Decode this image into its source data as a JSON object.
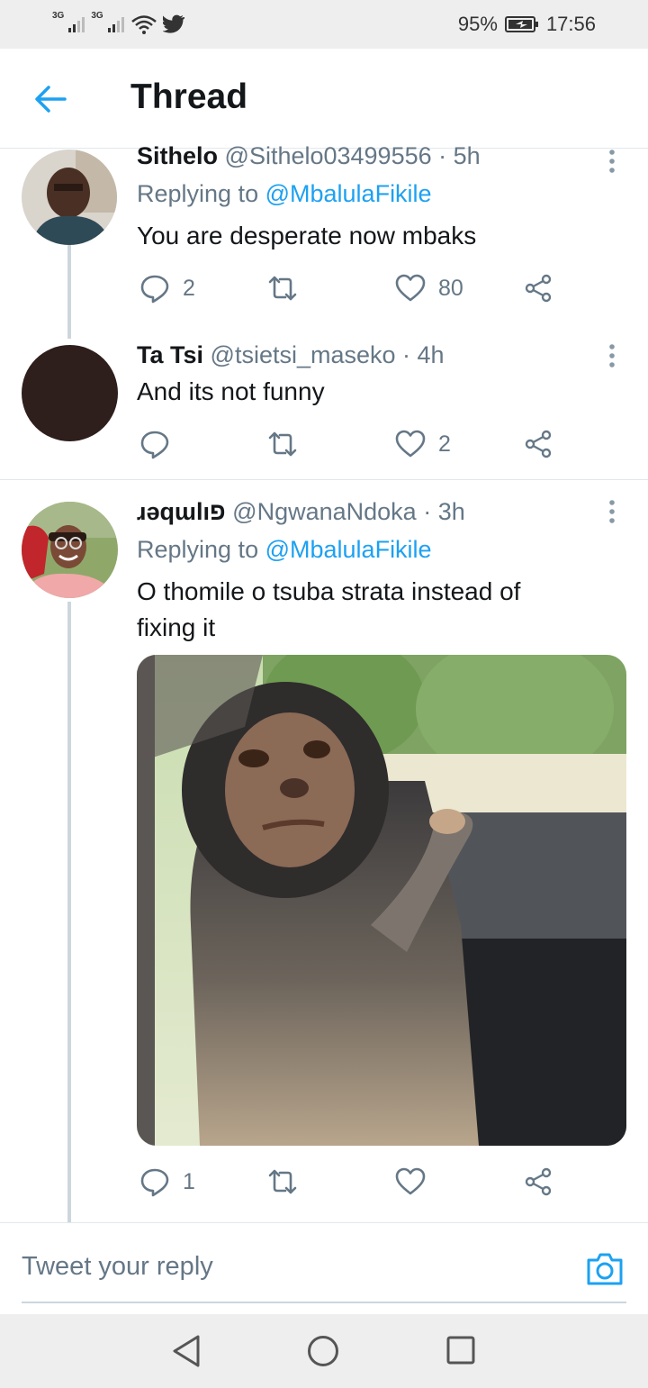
{
  "status_bar": {
    "signal1": "3G",
    "signal2": "3G",
    "battery_percent": "95%",
    "time": "17:56"
  },
  "header": {
    "title": "Thread"
  },
  "tweets": [
    {
      "name": "Sithelo",
      "handle": "@Sithelo03499556",
      "time": "· 5h",
      "replying_prefix": "Replying to",
      "replying_to": "@MbalulaFikile",
      "text": "You are desperate now mbaks",
      "replies": "2",
      "retweets": "",
      "likes": "80"
    },
    {
      "name": "Ta Tsi",
      "handle": "@tsietsi_maseko",
      "time": "· 4h",
      "text": "And its not funny",
      "replies": "",
      "retweets": "",
      "likes": "2"
    },
    {
      "name": "ɹǝqɯlıפ",
      "handle": "@NgwanaNdoka",
      "time": "· 3h",
      "replying_prefix": "Replying to",
      "replying_to": "@MbalulaFikile",
      "text_line1": "O thomile o tsuba strata instead of",
      "text_line2": "fixing it",
      "replies": "1",
      "retweets": "",
      "likes": ""
    }
  ],
  "reply_bar": {
    "placeholder": "Tweet your reply"
  },
  "colors": {
    "accent": "#1da1f2",
    "secondary_text": "#657786",
    "primary_text": "#14171a"
  }
}
